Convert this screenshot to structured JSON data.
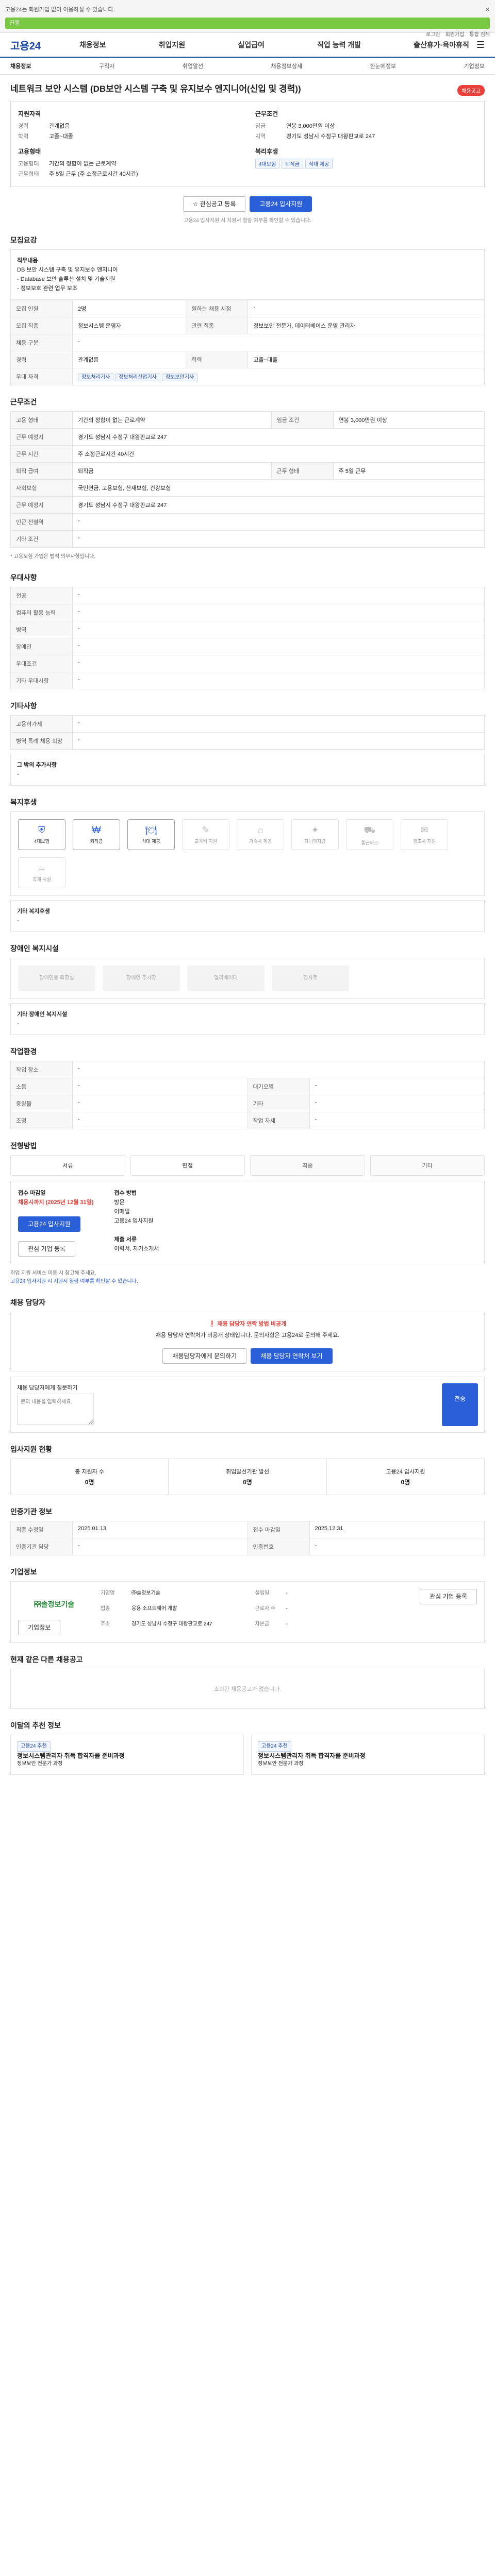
{
  "topbar": {
    "notice": "고용24는 회원가입 없이 이용하실 수 있습니다.",
    "progress_label": "진행",
    "progress": 1.0,
    "links": [
      "로그인",
      "회원가입",
      "통합 검색"
    ]
  },
  "gnb": {
    "logo": "고용24",
    "nav": [
      "채용정보",
      "취업지원",
      "실업급여",
      "직업 능력 개발",
      "출산휴가·육아휴직"
    ]
  },
  "subnav": {
    "items": [
      "채용정보",
      "구직자",
      "취업알선",
      "채용정보상세",
      "한눈에정보",
      "기업정보"
    ]
  },
  "job": {
    "title": "네트워크 보안 시스템 (DB보안 시스템 구축 및 유지보수 엔지니어(신입 및 경력))",
    "badge": "채용공고",
    "summary": {
      "left_title": "지원자격",
      "left": [
        {
          "k": "경력",
          "v": "관계없음"
        },
        {
          "k": "학력",
          "v": "고졸~대졸"
        }
      ],
      "left_title2": "고용형태",
      "left2": [
        {
          "k": "고용형태",
          "v": "기간의 정함이 없는 근로계약"
        },
        {
          "k": "근무형태",
          "v": "주 5일 근무 (주 소정근로시간 40시간)"
        }
      ],
      "right_title": "근무조건",
      "right": [
        {
          "k": "임금",
          "v": "연봉 3,000만원 이상"
        },
        {
          "k": "지역",
          "v": "경기도 성남시 수정구 대왕판교로 247"
        }
      ],
      "right_title2": "복리후생",
      "tags": [
        "4대보험",
        "퇴직금",
        "식대 제공"
      ]
    },
    "btn_interest": "관심공고 등록",
    "btn_apply": "고용24 입사지원",
    "note": "고용24 입사지원 시 지원서 열람 여부를 확인할 수 있습니다."
  },
  "recruit": {
    "title": "모집요강",
    "job_desc_label": "직무내용",
    "job_desc": "DB 보안 시스템 구축 및 유지보수 엔지니어\n- Database 보안 솔루션 설치 및 기술지원\n- 정보보호 관련 업무 보조",
    "rows": [
      {
        "k": "모집 인원",
        "v": "2명",
        "k2": "원하는 채용 시점",
        "v2": "-"
      },
      {
        "k": "모집 직종",
        "v": "정보시스템 운영자",
        "k2": "관련 직종",
        "v2": "정보보안 전문가, 데이터베이스 운영 관리자"
      },
      {
        "k": "채용 구분",
        "v": "-",
        "k2": "",
        "v2": ""
      },
      {
        "k": "경력",
        "v": "관계없음",
        "k2": "학력",
        "v2": "고졸~대졸"
      }
    ],
    "pref_label": "우대 자격",
    "pref": [
      "정보처리기사",
      "정보처리산업기사",
      "정보보안기사"
    ]
  },
  "work": {
    "title": "근무조건",
    "rows": [
      {
        "k": "고용 형태",
        "v": "기간의 정함이 없는 근로계약",
        "k2": "임금 조건",
        "v2": "연봉 3,000만원 이상"
      },
      {
        "k": "근무 예정지",
        "v": "경기도 성남시 수정구 대왕판교로 247",
        "k2": "",
        "v2": ""
      },
      {
        "k": "근무 시간",
        "v": "주 소정근로시간 40시간",
        "k2": "",
        "v2": ""
      },
      {
        "k": "퇴직 급여",
        "v": "퇴직금",
        "k2": "근무 형태",
        "v2": "주 5일 근무"
      },
      {
        "k": "사회보험",
        "v": "국민연금, 고용보험, 산재보험, 건강보험",
        "k2": "",
        "v2": ""
      },
      {
        "k": "근무 예정지",
        "v": "경기도 성남시 수정구 대왕판교로 247",
        "k2": "",
        "v2": ""
      },
      {
        "k": "인근 전철역",
        "v": "-",
        "k2": "",
        "v2": ""
      },
      {
        "k": "기타 조건",
        "v": "-",
        "k2": "",
        "v2": ""
      }
    ],
    "note": "* 고용보험 가입은 법적 의무사항입니다."
  },
  "pref": {
    "title": "우대사항",
    "rows": [
      {
        "k": "전공",
        "v": "-"
      },
      {
        "k": "컴퓨터 활용 능력",
        "v": "-"
      },
      {
        "k": "병역",
        "v": "-"
      },
      {
        "k": "장애인",
        "v": "-"
      },
      {
        "k": "우대조건",
        "v": "-"
      },
      {
        "k": "기타 우대사항",
        "v": "-"
      }
    ]
  },
  "etc": {
    "title": "기타사항",
    "rows": [
      {
        "k": "고용허가제",
        "v": "-"
      },
      {
        "k": "병역 특례 채용 희망",
        "v": "-"
      }
    ],
    "note_label": "그 밖의 추가사항",
    "note": "-"
  },
  "welfare": {
    "title": "복지후생",
    "items": [
      {
        "label": "4대보험",
        "on": true
      },
      {
        "label": "퇴직금",
        "on": true
      },
      {
        "label": "식대 제공",
        "on": true
      },
      {
        "label": "교육비 지원",
        "on": false
      },
      {
        "label": "기숙사 제공",
        "on": false
      },
      {
        "label": "자녀학자금",
        "on": false
      },
      {
        "label": "통근버스",
        "on": false
      },
      {
        "label": "경조사 지원",
        "on": false
      },
      {
        "label": "휴게 시설",
        "on": false
      }
    ],
    "note_label": "기타 복지후생",
    "note": "-"
  },
  "disabled": {
    "title": "장애인 복지시설",
    "items": [
      "장애인용 화장실",
      "장애인 주차장",
      "엘리베이터",
      "경사로"
    ],
    "note_label": "기타 장애인 복지시설",
    "note": "-"
  },
  "env": {
    "title": "작업환경",
    "rows": [
      {
        "k": "작업 장소",
        "v": "-",
        "k2": "",
        "v2": ""
      },
      {
        "k": "소음",
        "v": "-",
        "k2": "대기오염",
        "v2": "-"
      },
      {
        "k": "중량물",
        "v": "-",
        "k2": "기타",
        "v2": "-"
      },
      {
        "k": "조명",
        "v": "-",
        "k2": "작업 자세",
        "v2": "-"
      }
    ]
  },
  "process": {
    "title": "전형방법",
    "steps": [
      "서류",
      "면접",
      "최종",
      "기타"
    ],
    "apply_label": "접수 마감일",
    "deadline": "채용시까지 (2025년 12월 31일)",
    "method_label": "접수 방법",
    "methods": [
      "방문",
      "이메일",
      "고용24 입사지원"
    ],
    "docs_label": "제출 서류",
    "docs": "이력서, 자기소개서",
    "btn1": "고용24 입사지원",
    "btn2": "관심 기업 등록",
    "bullets": [
      "취업 지원 서비스 이용 시 참고해 주세요.",
      "고용24 입사지원 시 지원서 열람 여부를 확인할 수 있습니다."
    ]
  },
  "contact": {
    "title": "채용 담당자",
    "alert": "채용 담당자 연락 방법 비공개",
    "desc": "채용 담당자 연락처가 비공개 상태입니다. 문의사항은 고용24로 문의해 주세요.",
    "btn1": "채용담당자에게 문의하기",
    "btn2": "채용 담당자 연락처 보기",
    "q_label": "채용 담당자에게 질문하기",
    "q_placeholder": "문의 내용을 입력하세요.",
    "q_send": "전송"
  },
  "stats": {
    "title": "입사지원 현황",
    "items": [
      {
        "label": "총 지원자 수",
        "num": "0명"
      },
      {
        "label": "취업알선기관 알선",
        "num": "0명"
      },
      {
        "label": "고용24 입사지원",
        "num": "0명"
      }
    ]
  },
  "info": {
    "title": "인증기관 정보",
    "rows": [
      {
        "k": "최종 수정일",
        "v": "2025.01.13",
        "k2": "접수 마감일",
        "v2": "2025.12.31"
      },
      {
        "k": "인증기관 담당",
        "v": "-",
        "k2": "인증번호",
        "v2": "-"
      }
    ]
  },
  "company": {
    "title": "기업정보",
    "name": "㈜솔정보기술",
    "rows": [
      {
        "k": "기업명",
        "v": "㈜솔정보기술",
        "k2": "설립일",
        "v2": "-"
      },
      {
        "k": "업종",
        "v": "응용 소프트웨어 개발",
        "k2": "근로자 수",
        "v2": "-"
      },
      {
        "k": "주소",
        "v": "경기도 성남시 수정구 대왕판교로 247",
        "k2": "자본금",
        "v2": "-"
      }
    ],
    "btn1": "기업정보",
    "btn2": "관심 기업 등록"
  },
  "similar": {
    "title": "현재 같은 다른 채용공고",
    "empty": "조회된 채용공고가 없습니다."
  },
  "reco": {
    "title": "이달의 추천 정보",
    "cards": [
      {
        "tag": "고용24 추천",
        "title": "정보시스템관리자 취득 합격자를 준비과정",
        "sub": "정보보안 전문가 과정"
      },
      {
        "tag": "고용24 추천",
        "title": "정보시스템관리자 취득 합격자를 준비과정",
        "sub": "정보보안 전문가 과정"
      }
    ]
  }
}
